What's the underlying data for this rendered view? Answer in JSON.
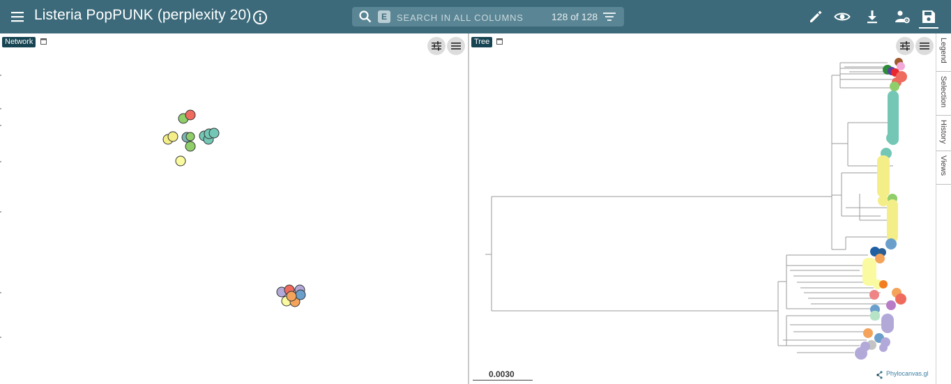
{
  "app": {
    "title": "Listeria PopPUNK (perplexity 20)"
  },
  "search": {
    "placeholder": "SEARCH IN ALL COLUMNS",
    "chip": "E",
    "count": "128 of 128"
  },
  "toolbar": {
    "icons": [
      "pencil-icon",
      "eye-icon",
      "download-icon",
      "user-settings-icon",
      "save-icon"
    ]
  },
  "panels": {
    "network": {
      "tag": "Network"
    },
    "tree": {
      "tag": "Tree",
      "scale": "0.0030",
      "brand": "Phylocanvas.gl"
    }
  },
  "side_tabs": [
    "Legend",
    "Selection",
    "History",
    "Views"
  ],
  "colors": {
    "header": "#3c6a7a",
    "tag": "#174452",
    "teal": "#74c7b5",
    "yellow": "#f4ee88",
    "green": "#8fce6a",
    "red": "#ef6b5e",
    "purple": "#b2a9d9",
    "orange": "#f4a35b",
    "blue": "#6a9fcb"
  }
}
